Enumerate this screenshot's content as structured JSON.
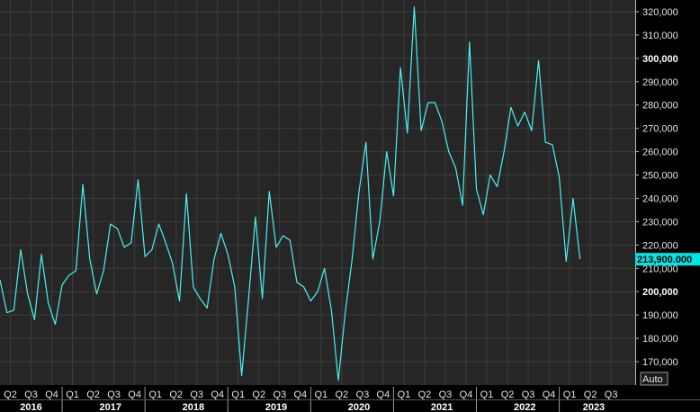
{
  "chart_data": {
    "type": "line",
    "title": "",
    "xlabel": "",
    "ylabel": "",
    "ylim": [
      160000,
      325000
    ],
    "yticks": [
      170000,
      180000,
      190000,
      200000,
      210000,
      220000,
      230000,
      240000,
      250000,
      260000,
      270000,
      280000,
      290000,
      300000,
      310000,
      320000
    ],
    "ytick_labels": [
      "170,000",
      "180,000",
      "190,000",
      "200,000",
      "210,000",
      "220,000",
      "230,000",
      "240,000",
      "250,000",
      "260,000",
      "270,000",
      "280,000",
      "290,000",
      "300,000",
      "310,000",
      "320,000"
    ],
    "bold_ticks": [
      200000,
      300000
    ],
    "x_range": [
      0,
      92
    ],
    "quarter_ticks": [
      {
        "x": 1.5,
        "label": "Q2"
      },
      {
        "x": 4.5,
        "label": "Q3"
      },
      {
        "x": 7.5,
        "label": "Q4"
      },
      {
        "x": 10.5,
        "label": "Q1"
      },
      {
        "x": 13.5,
        "label": "Q2"
      },
      {
        "x": 16.5,
        "label": "Q3"
      },
      {
        "x": 19.5,
        "label": "Q4"
      },
      {
        "x": 22.5,
        "label": "Q1"
      },
      {
        "x": 25.5,
        "label": "Q2"
      },
      {
        "x": 28.5,
        "label": "Q3"
      },
      {
        "x": 31.5,
        "label": "Q4"
      },
      {
        "x": 34.5,
        "label": "Q1"
      },
      {
        "x": 37.5,
        "label": "Q2"
      },
      {
        "x": 40.5,
        "label": "Q3"
      },
      {
        "x": 43.5,
        "label": "Q4"
      },
      {
        "x": 46.5,
        "label": "Q1"
      },
      {
        "x": 49.5,
        "label": "Q2"
      },
      {
        "x": 52.5,
        "label": "Q3"
      },
      {
        "x": 55.5,
        "label": "Q4"
      },
      {
        "x": 58.5,
        "label": "Q1"
      },
      {
        "x": 61.5,
        "label": "Q2"
      },
      {
        "x": 64.5,
        "label": "Q3"
      },
      {
        "x": 67.5,
        "label": "Q4"
      },
      {
        "x": 70.5,
        "label": "Q1"
      },
      {
        "x": 73.5,
        "label": "Q2"
      },
      {
        "x": 76.5,
        "label": "Q3"
      },
      {
        "x": 79.5,
        "label": "Q4"
      },
      {
        "x": 82.5,
        "label": "Q1"
      },
      {
        "x": 85.5,
        "label": "Q2"
      },
      {
        "x": 88.5,
        "label": "Q3"
      }
    ],
    "year_ticks": [
      {
        "x": 4.5,
        "label": "2016"
      },
      {
        "x": 16,
        "label": "2017"
      },
      {
        "x": 28,
        "label": "2018"
      },
      {
        "x": 40,
        "label": "2019"
      },
      {
        "x": 52,
        "label": "2020"
      },
      {
        "x": 64,
        "label": "2021"
      },
      {
        "x": 76,
        "label": "2022"
      },
      {
        "x": 86,
        "label": "2023"
      }
    ],
    "year_boundaries": [
      9,
      21,
      33,
      45,
      57,
      69,
      81
    ],
    "series": [
      {
        "line_color": "#4df0f0",
        "values": [
          205000,
          191000,
          192000,
          218000,
          199000,
          188000,
          216000,
          195000,
          186000,
          203000,
          207000,
          209000,
          246000,
          214000,
          199000,
          209000,
          229000,
          227000,
          219000,
          221000,
          248000,
          215000,
          218000,
          229000,
          221000,
          212000,
          196000,
          242000,
          202000,
          197000,
          193000,
          214000,
          225000,
          216000,
          202000,
          164000,
          197000,
          232000,
          197000,
          243000,
          219000,
          224000,
          222000,
          204000,
          202000,
          196000,
          200000,
          210000,
          192000,
          162000,
          191000,
          214000,
          243000,
          264000,
          214000,
          230000,
          260000,
          241000,
          296000,
          268000,
          322000,
          269000,
          281000,
          281000,
          273000,
          260000,
          253000,
          237000,
          307000,
          244000,
          233000,
          250000,
          245000,
          260000,
          279000,
          271000,
          277000,
          269000,
          299000,
          264000,
          263000,
          249000,
          213000,
          240000,
          213900
        ]
      }
    ],
    "last_value_label": "213,900.000",
    "last_value_color": "#00e5e5",
    "axis_button_label": "Auto",
    "grid": true,
    "background_color": "#262626",
    "grid_color": "#3d3d3d"
  }
}
